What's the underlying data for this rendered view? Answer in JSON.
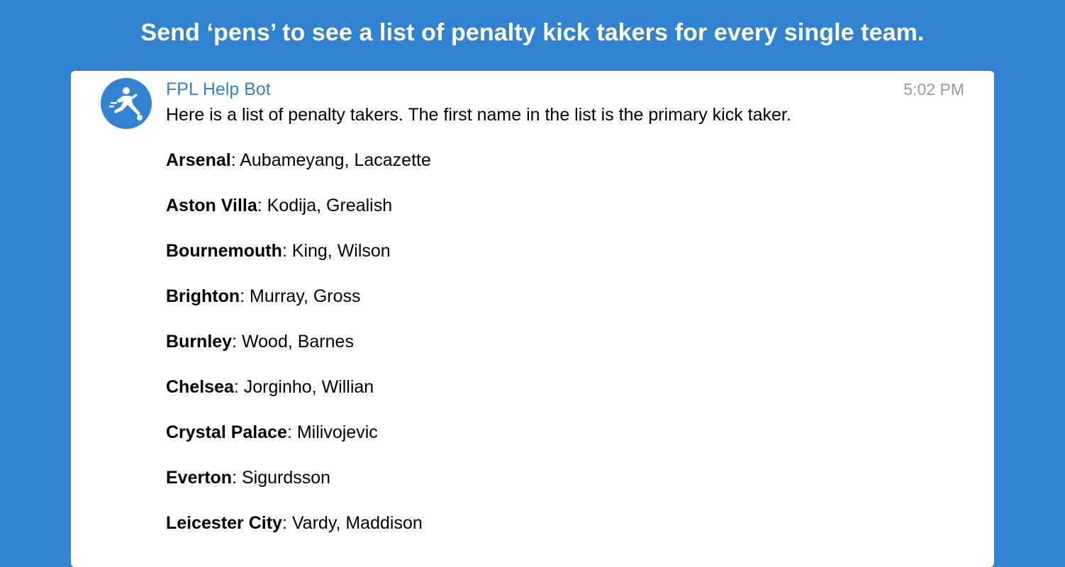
{
  "banner": {
    "text": "Send ‘pens’ to see a list of penalty kick takers for every single team."
  },
  "message": {
    "sender": "FPL Help Bot",
    "timestamp": "5:02 PM",
    "avatar_icon": "penalty-kicker-icon",
    "intro": "Here is a list of penalty takers. The first name in the list is the primary kick taker.",
    "teams": [
      {
        "name": "Arsenal",
        "takers": ": Aubameyang, Lacazette"
      },
      {
        "name": "Aston Villa",
        "takers": ": Kodija, Grealish"
      },
      {
        "name": "Bournemouth",
        "takers": ": King, Wilson"
      },
      {
        "name": "Brighton",
        "takers": ": Murray, Gross"
      },
      {
        "name": "Burnley",
        "takers": ": Wood, Barnes"
      },
      {
        "name": "Chelsea",
        "takers": ": Jorginho, Willian"
      },
      {
        "name": "Crystal Palace",
        "takers": ": Milivojevic"
      },
      {
        "name": "Everton",
        "takers": ": Sigurdsson"
      },
      {
        "name": "Leicester City",
        "takers": ": Vardy, Maddison"
      }
    ]
  },
  "colors": {
    "background": "#3182D0",
    "sender": "#3182D0",
    "timestamp": "#9a9a9a",
    "card": "#ffffff"
  }
}
